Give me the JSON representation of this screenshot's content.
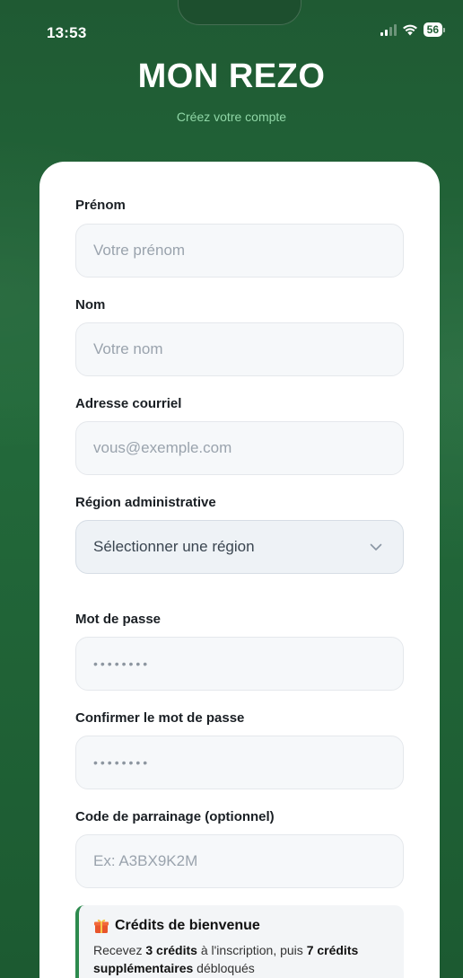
{
  "status": {
    "time": "13:53",
    "battery": "56"
  },
  "header": {
    "title": "MON REZO",
    "subtitle": "Créez votre compte"
  },
  "form": {
    "first_name_label": "Prénom",
    "first_name_placeholder": "Votre prénom",
    "last_name_label": "Nom",
    "last_name_placeholder": "Votre nom",
    "email_label": "Adresse courriel",
    "email_placeholder": "vous@exemple.com",
    "region_label": "Région administrative",
    "region_value": "Sélectionner une région",
    "password_label": "Mot de passe",
    "password_value": "••••••••",
    "confirm_label": "Confirmer le mot de passe",
    "confirm_value": "••••••••",
    "referral_label": "Code de parrainage (optionnel)",
    "referral_placeholder": "Ex: A3BX9K2M"
  },
  "bonus": {
    "title": "Crédits de bienvenue",
    "text_1": "Recevez ",
    "text_bold_1": "3 crédits",
    "text_2": " à l'inscription, puis ",
    "text_bold_2": "7 crédits supplémentaires",
    "text_3": " débloqués"
  },
  "colors": {
    "background": "#1f5e34",
    "accent": "#2d8a4e",
    "subtitle": "#8fd6a6"
  }
}
